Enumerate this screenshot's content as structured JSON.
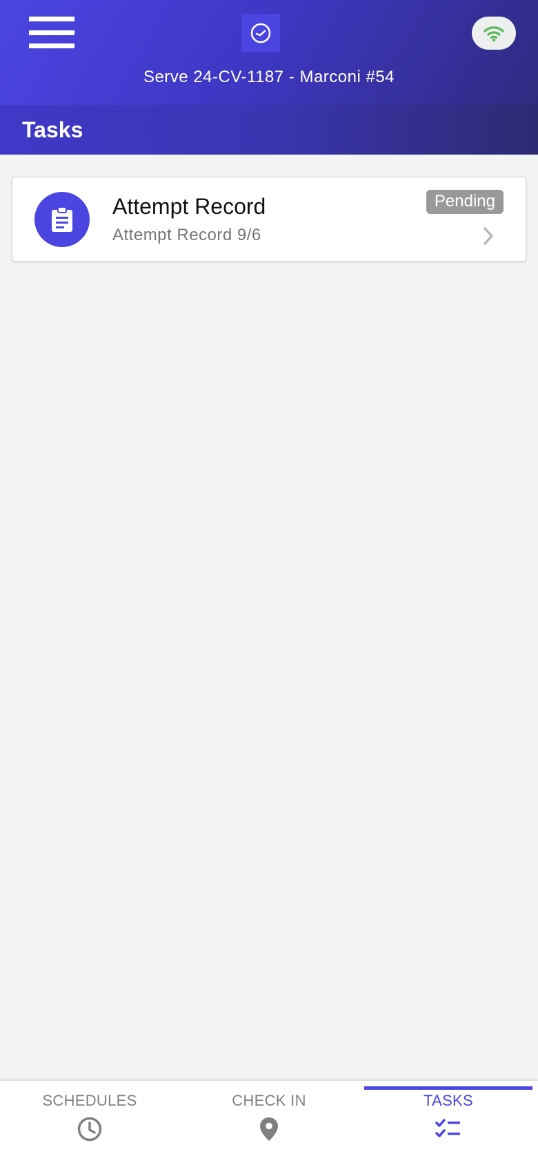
{
  "header": {
    "subtitle": "Serve 24-CV-1187 - Marconi #54",
    "section_title": "Tasks",
    "icons": {
      "menu": "menu-icon",
      "logo": "clock-logo-icon",
      "connection": "wifi-icon"
    }
  },
  "tasks": [
    {
      "title": "Attempt Record",
      "subtitle": "Attempt Record 9/6",
      "status": "Pending",
      "icon": "clipboard-icon"
    }
  ],
  "bottom_nav": {
    "tabs": [
      {
        "label": "SCHEDULES",
        "icon": "clock-icon",
        "active": false
      },
      {
        "label": "CHECK IN",
        "icon": "location-pin-icon",
        "active": false
      },
      {
        "label": "TASKS",
        "icon": "checklist-icon",
        "active": true
      }
    ]
  },
  "colors": {
    "primary": "#4b45e2",
    "header_dark": "#2e2a7a",
    "status_pending": "#999999",
    "wifi_green": "#5cb85c",
    "inactive_tab": "#808080"
  }
}
